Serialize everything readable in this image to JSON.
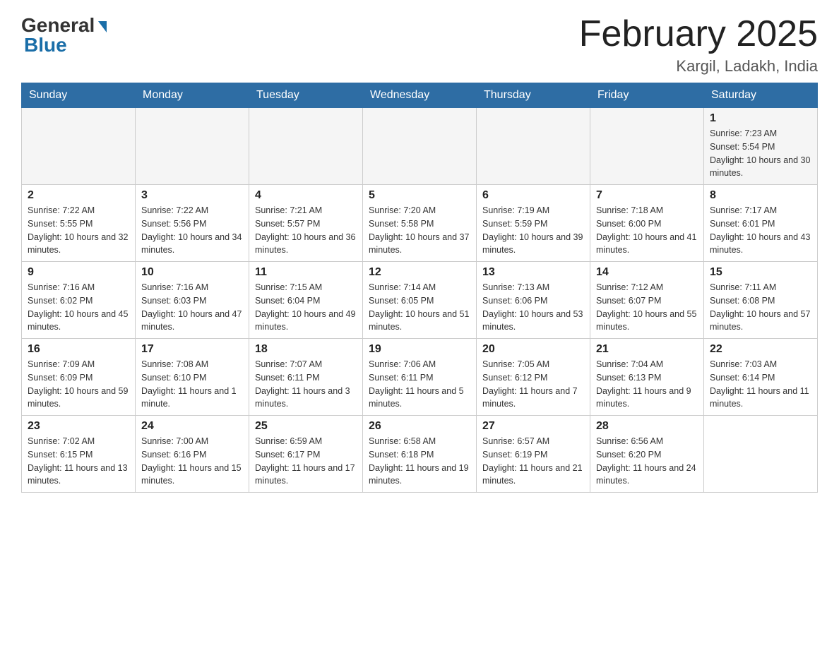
{
  "header": {
    "logo_general": "General",
    "logo_blue": "Blue",
    "title": "February 2025",
    "subtitle": "Kargil, Ladakh, India"
  },
  "calendar": {
    "weekdays": [
      "Sunday",
      "Monday",
      "Tuesday",
      "Wednesday",
      "Thursday",
      "Friday",
      "Saturday"
    ],
    "weeks": [
      [
        {
          "day": "",
          "sunrise": "",
          "sunset": "",
          "daylight": ""
        },
        {
          "day": "",
          "sunrise": "",
          "sunset": "",
          "daylight": ""
        },
        {
          "day": "",
          "sunrise": "",
          "sunset": "",
          "daylight": ""
        },
        {
          "day": "",
          "sunrise": "",
          "sunset": "",
          "daylight": ""
        },
        {
          "day": "",
          "sunrise": "",
          "sunset": "",
          "daylight": ""
        },
        {
          "day": "",
          "sunrise": "",
          "sunset": "",
          "daylight": ""
        },
        {
          "day": "1",
          "sunrise": "Sunrise: 7:23 AM",
          "sunset": "Sunset: 5:54 PM",
          "daylight": "Daylight: 10 hours and 30 minutes."
        }
      ],
      [
        {
          "day": "2",
          "sunrise": "Sunrise: 7:22 AM",
          "sunset": "Sunset: 5:55 PM",
          "daylight": "Daylight: 10 hours and 32 minutes."
        },
        {
          "day": "3",
          "sunrise": "Sunrise: 7:22 AM",
          "sunset": "Sunset: 5:56 PM",
          "daylight": "Daylight: 10 hours and 34 minutes."
        },
        {
          "day": "4",
          "sunrise": "Sunrise: 7:21 AM",
          "sunset": "Sunset: 5:57 PM",
          "daylight": "Daylight: 10 hours and 36 minutes."
        },
        {
          "day": "5",
          "sunrise": "Sunrise: 7:20 AM",
          "sunset": "Sunset: 5:58 PM",
          "daylight": "Daylight: 10 hours and 37 minutes."
        },
        {
          "day": "6",
          "sunrise": "Sunrise: 7:19 AM",
          "sunset": "Sunset: 5:59 PM",
          "daylight": "Daylight: 10 hours and 39 minutes."
        },
        {
          "day": "7",
          "sunrise": "Sunrise: 7:18 AM",
          "sunset": "Sunset: 6:00 PM",
          "daylight": "Daylight: 10 hours and 41 minutes."
        },
        {
          "day": "8",
          "sunrise": "Sunrise: 7:17 AM",
          "sunset": "Sunset: 6:01 PM",
          "daylight": "Daylight: 10 hours and 43 minutes."
        }
      ],
      [
        {
          "day": "9",
          "sunrise": "Sunrise: 7:16 AM",
          "sunset": "Sunset: 6:02 PM",
          "daylight": "Daylight: 10 hours and 45 minutes."
        },
        {
          "day": "10",
          "sunrise": "Sunrise: 7:16 AM",
          "sunset": "Sunset: 6:03 PM",
          "daylight": "Daylight: 10 hours and 47 minutes."
        },
        {
          "day": "11",
          "sunrise": "Sunrise: 7:15 AM",
          "sunset": "Sunset: 6:04 PM",
          "daylight": "Daylight: 10 hours and 49 minutes."
        },
        {
          "day": "12",
          "sunrise": "Sunrise: 7:14 AM",
          "sunset": "Sunset: 6:05 PM",
          "daylight": "Daylight: 10 hours and 51 minutes."
        },
        {
          "day": "13",
          "sunrise": "Sunrise: 7:13 AM",
          "sunset": "Sunset: 6:06 PM",
          "daylight": "Daylight: 10 hours and 53 minutes."
        },
        {
          "day": "14",
          "sunrise": "Sunrise: 7:12 AM",
          "sunset": "Sunset: 6:07 PM",
          "daylight": "Daylight: 10 hours and 55 minutes."
        },
        {
          "day": "15",
          "sunrise": "Sunrise: 7:11 AM",
          "sunset": "Sunset: 6:08 PM",
          "daylight": "Daylight: 10 hours and 57 minutes."
        }
      ],
      [
        {
          "day": "16",
          "sunrise": "Sunrise: 7:09 AM",
          "sunset": "Sunset: 6:09 PM",
          "daylight": "Daylight: 10 hours and 59 minutes."
        },
        {
          "day": "17",
          "sunrise": "Sunrise: 7:08 AM",
          "sunset": "Sunset: 6:10 PM",
          "daylight": "Daylight: 11 hours and 1 minute."
        },
        {
          "day": "18",
          "sunrise": "Sunrise: 7:07 AM",
          "sunset": "Sunset: 6:11 PM",
          "daylight": "Daylight: 11 hours and 3 minutes."
        },
        {
          "day": "19",
          "sunrise": "Sunrise: 7:06 AM",
          "sunset": "Sunset: 6:11 PM",
          "daylight": "Daylight: 11 hours and 5 minutes."
        },
        {
          "day": "20",
          "sunrise": "Sunrise: 7:05 AM",
          "sunset": "Sunset: 6:12 PM",
          "daylight": "Daylight: 11 hours and 7 minutes."
        },
        {
          "day": "21",
          "sunrise": "Sunrise: 7:04 AM",
          "sunset": "Sunset: 6:13 PM",
          "daylight": "Daylight: 11 hours and 9 minutes."
        },
        {
          "day": "22",
          "sunrise": "Sunrise: 7:03 AM",
          "sunset": "Sunset: 6:14 PM",
          "daylight": "Daylight: 11 hours and 11 minutes."
        }
      ],
      [
        {
          "day": "23",
          "sunrise": "Sunrise: 7:02 AM",
          "sunset": "Sunset: 6:15 PM",
          "daylight": "Daylight: 11 hours and 13 minutes."
        },
        {
          "day": "24",
          "sunrise": "Sunrise: 7:00 AM",
          "sunset": "Sunset: 6:16 PM",
          "daylight": "Daylight: 11 hours and 15 minutes."
        },
        {
          "day": "25",
          "sunrise": "Sunrise: 6:59 AM",
          "sunset": "Sunset: 6:17 PM",
          "daylight": "Daylight: 11 hours and 17 minutes."
        },
        {
          "day": "26",
          "sunrise": "Sunrise: 6:58 AM",
          "sunset": "Sunset: 6:18 PM",
          "daylight": "Daylight: 11 hours and 19 minutes."
        },
        {
          "day": "27",
          "sunrise": "Sunrise: 6:57 AM",
          "sunset": "Sunset: 6:19 PM",
          "daylight": "Daylight: 11 hours and 21 minutes."
        },
        {
          "day": "28",
          "sunrise": "Sunrise: 6:56 AM",
          "sunset": "Sunset: 6:20 PM",
          "daylight": "Daylight: 11 hours and 24 minutes."
        },
        {
          "day": "",
          "sunrise": "",
          "sunset": "",
          "daylight": ""
        }
      ]
    ]
  }
}
